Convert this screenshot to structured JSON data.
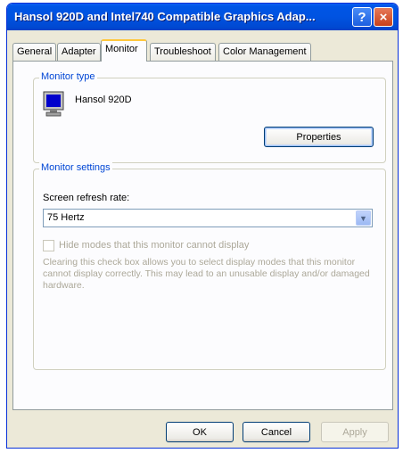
{
  "window": {
    "title": "Hansol 920D and Intel740 Compatible Graphics Adap...",
    "help_label": "?",
    "close_label": "×"
  },
  "tabs": [
    {
      "label": "General"
    },
    {
      "label": "Adapter"
    },
    {
      "label": "Monitor"
    },
    {
      "label": "Troubleshoot"
    },
    {
      "label": "Color Management"
    }
  ],
  "monitor_type": {
    "legend": "Monitor type",
    "monitor_name": "Hansol 920D",
    "properties_label": "Properties"
  },
  "monitor_settings": {
    "legend": "Monitor settings",
    "refresh_label": "Screen refresh rate:",
    "refresh_value": "75 Hertz",
    "hide_modes_label": "Hide modes that this monitor cannot display",
    "hide_modes_checked": false,
    "description": "Clearing this check box allows you to select display modes that this monitor cannot display correctly. This may lead to an unusable display and/or damaged hardware."
  },
  "buttons": {
    "ok": "OK",
    "cancel": "Cancel",
    "apply": "Apply"
  },
  "colors": {
    "titlebar": "#0055e5",
    "legend": "#0046d5",
    "active_tab_accent": "#ffc73c"
  }
}
